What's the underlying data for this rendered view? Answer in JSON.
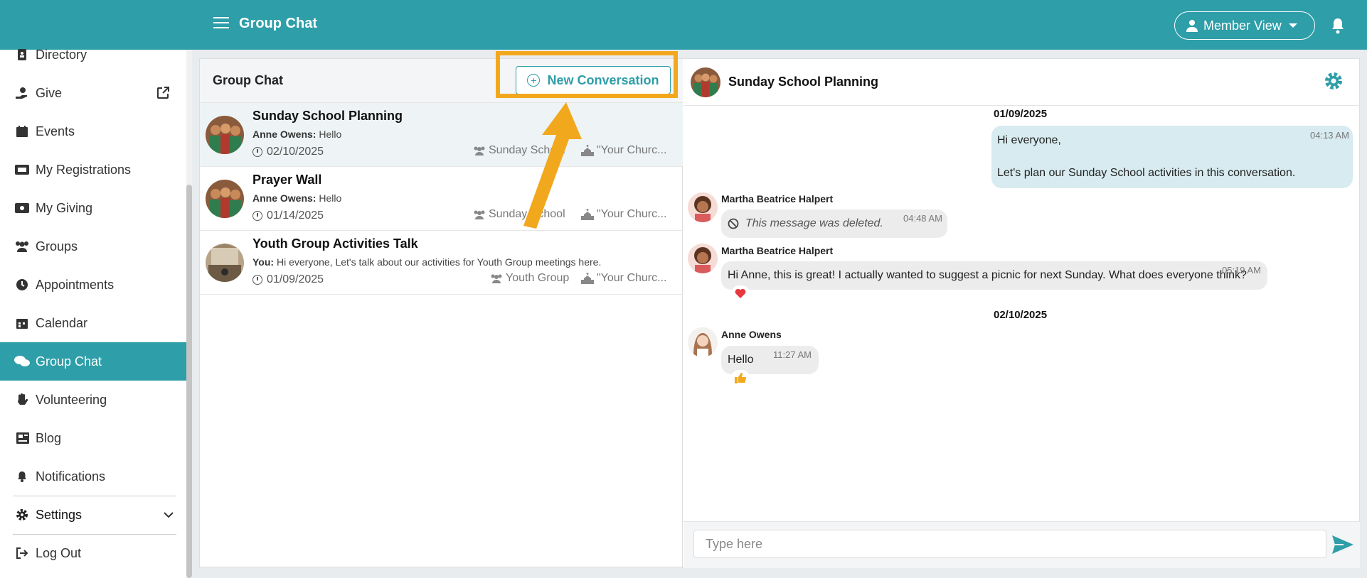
{
  "header": {
    "title": "Group Chat",
    "member_view_label": "Member View"
  },
  "sidebar": {
    "items": [
      {
        "label": "Directory"
      },
      {
        "label": "Give"
      },
      {
        "label": "Events"
      },
      {
        "label": "My Registrations"
      },
      {
        "label": "My Giving"
      },
      {
        "label": "Groups"
      },
      {
        "label": "Appointments"
      },
      {
        "label": "Calendar"
      },
      {
        "label": "Group Chat"
      },
      {
        "label": "Volunteering"
      },
      {
        "label": "Blog"
      },
      {
        "label": "Notifications"
      },
      {
        "label": "Settings"
      },
      {
        "label": "Log Out"
      }
    ]
  },
  "list": {
    "title": "Group Chat",
    "new_conversation_label": "New Conversation",
    "conversations": [
      {
        "name": "Sunday School Planning",
        "sender": "Anne Owens:",
        "message": "Hello",
        "date": "02/10/2025",
        "group": "Sunday School",
        "church": "\"Your Churc..."
      },
      {
        "name": "Prayer Wall",
        "sender": "Anne Owens:",
        "message": "Hello",
        "date": "01/14/2025",
        "group": "Sunday School",
        "church": "\"Your Churc..."
      },
      {
        "name": "Youth Group Activities Talk",
        "sender": "You:",
        "message": "Hi everyone, Let's talk about our activities for Youth Group meetings here.",
        "date": "01/09/2025",
        "group": "Youth Group",
        "church": "\"Your Churc..."
      }
    ]
  },
  "chat": {
    "title": "Sunday School Planning",
    "date_1": "01/09/2025",
    "date_2": "02/10/2025",
    "messages": [
      {
        "line1": "Hi everyone,",
        "line2": "Let's plan our Sunday School activities in this conversation.",
        "time": "04:13 AM"
      },
      {
        "sender": "Martha Beatrice Halpert",
        "text": "This message was deleted.",
        "time": "04:48 AM"
      },
      {
        "sender": "Martha Beatrice Halpert",
        "text": "Hi Anne, this is great! I actually wanted to suggest a picnic for next Sunday. What does everyone think?",
        "time": "05:19 AM",
        "reaction": "heart"
      },
      {
        "sender": "Anne Owens",
        "text": "Hello",
        "time": "11:27 AM",
        "reaction": "thumbs-up"
      }
    ],
    "composer_placeholder": "Type here"
  },
  "colors": {
    "accent": "#2e9ea8",
    "highlight": "#f2a81d",
    "mine_bubble": "#d7ebf0",
    "other_bubble": "#ececec"
  }
}
